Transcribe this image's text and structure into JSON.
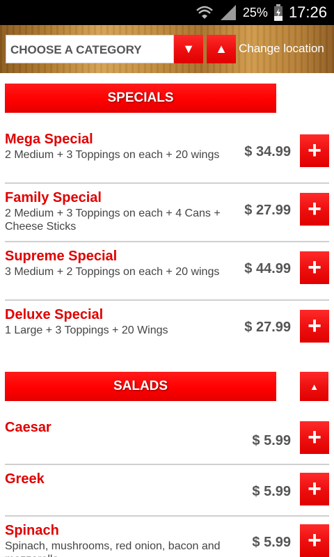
{
  "status_bar": {
    "battery": "25%",
    "time": "17:26"
  },
  "header": {
    "category_placeholder": "CHOOSE A CATEGORY",
    "dropdown_arrow": "▼",
    "up_arrow": "▲",
    "change_location": "Change location"
  },
  "sections": [
    {
      "title": "SPECIALS",
      "items": [
        {
          "name": "Mega Special",
          "desc": "2 Medium + 3 Toppings on each + 20 wings",
          "price": "$ 34.99"
        },
        {
          "name": "Family Special",
          "desc": "2 Medium + 3 Toppings on each + 4 Cans + Cheese Sticks",
          "price": "$ 27.99"
        },
        {
          "name": "Supreme Special",
          "desc": "3 Medium + 2 Toppings on each + 20 wings",
          "price": "$ 44.99"
        },
        {
          "name": "Deluxe Special",
          "desc": "1 Large + 3 Toppings + 20 Wings",
          "price": "$ 27.99"
        }
      ]
    },
    {
      "title": "SALADS",
      "collapse_arrow": "▲",
      "items": [
        {
          "name": "Caesar",
          "desc": "",
          "price": "$ 5.99"
        },
        {
          "name": "Greek",
          "desc": "",
          "price": "$ 5.99"
        },
        {
          "name": "Spinach",
          "desc": "Spinach, mushrooms, red onion, bacon and mozzarella",
          "price": "$ 5.99"
        }
      ]
    }
  ],
  "add_label": "+"
}
